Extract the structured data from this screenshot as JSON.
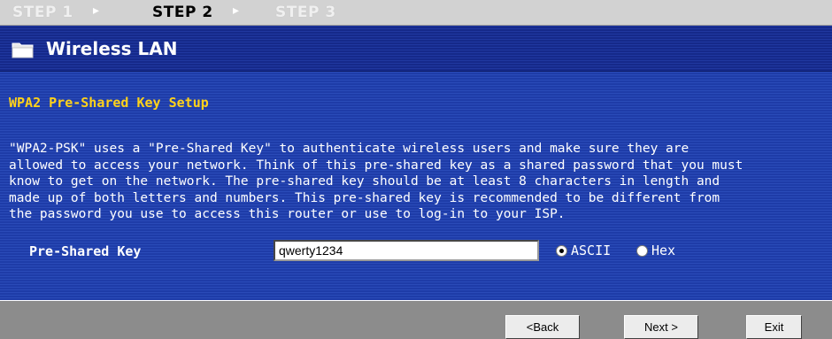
{
  "stepper": {
    "step1": "STEP 1",
    "step2": "STEP 2",
    "step3": "STEP 3",
    "separator": "▸",
    "active_step": "STEP 2"
  },
  "header": {
    "title": "Wireless LAN",
    "icon": "folder-icon"
  },
  "section": {
    "subtitle": "WPA2 Pre-Shared Key Setup",
    "description": "\"WPA2-PSK\" uses a \"Pre-Shared Key\" to authenticate wireless users and make sure they are\nallowed to access your network. Think of this pre-shared key as a shared password that you must\nknow to get on the network. The pre-shared key should be at least 8 characters in length and\nmade up of both letters and numbers. This pre-shared key is recommended to be different from\nthe password you use to access this router or use to log-in to your ISP."
  },
  "form": {
    "psk_label": "Pre-Shared Key",
    "psk_value": "qwerty1234",
    "format_options": [
      "ASCII",
      "Hex"
    ],
    "selected_format": "ASCII"
  },
  "buttons": {
    "back": "<Back",
    "next": "Next >",
    "exit": "Exit"
  },
  "colors": {
    "panel_blue": "#1e3ca8",
    "header_blue": "#15298a",
    "subtitle_yellow": "#ffd21a",
    "footer_gray": "#8c8c8c"
  }
}
